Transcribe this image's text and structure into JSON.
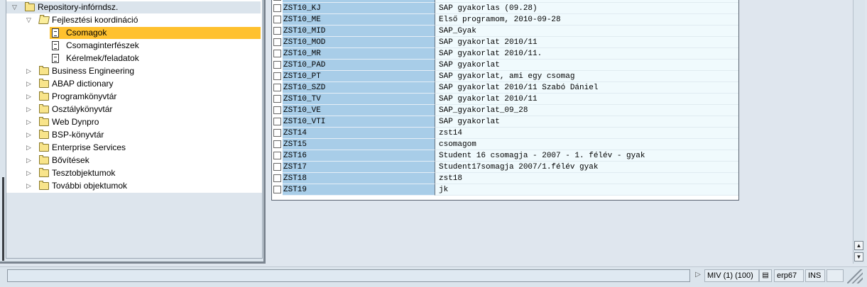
{
  "tree": {
    "nodes": [
      {
        "label": "Repository-infórndsz.",
        "toggle": "open"
      },
      {
        "label": "Fejlesztési koordináció",
        "toggle": "open"
      },
      {
        "label": "Csomagok",
        "selected": true
      },
      {
        "label": "Csomaginterfészek"
      },
      {
        "label": "Kérelmek/feladatok"
      },
      {
        "label": "Business Engineering",
        "toggle": "closed"
      },
      {
        "label": "ABAP dictionary",
        "toggle": "closed"
      },
      {
        "label": "Programkönyvtár",
        "toggle": "closed"
      },
      {
        "label": "Osztálykönyvtár",
        "toggle": "closed"
      },
      {
        "label": "Web Dynpro",
        "toggle": "closed"
      },
      {
        "label": "BSP-könyvtár",
        "toggle": "closed"
      },
      {
        "label": "Enterprise Services",
        "toggle": "closed"
      },
      {
        "label": "Bővítések",
        "toggle": "closed"
      },
      {
        "label": "Tesztobjektumok",
        "toggle": "closed"
      },
      {
        "label": "További objektumok",
        "toggle": "closed"
      }
    ]
  },
  "table": {
    "rows": [
      {
        "name": "ZST10_KJ",
        "desc": "SAP gyakorlas (09.28)"
      },
      {
        "name": "ZST10_ME",
        "desc": "Első programom, 2010-09-28"
      },
      {
        "name": "ZST10_MID",
        "desc": "SAP_Gyak"
      },
      {
        "name": "ZST10_MOD",
        "desc": "SAP gyakorlat 2010/11"
      },
      {
        "name": "ZST10_MR",
        "desc": "SAP gyakorlat 2010/11."
      },
      {
        "name": "ZST10_PAD",
        "desc": "SAP gyakorlat"
      },
      {
        "name": "ZST10_PT",
        "desc": "SAP gyakorlat, ami egy csomag"
      },
      {
        "name": "ZST10_SZD",
        "desc": "SAP gyakorlat 2010/11 Szabó Dániel"
      },
      {
        "name": "ZST10_TV",
        "desc": "SAP gyakorlat 2010/11"
      },
      {
        "name": "ZST10_VE",
        "desc": "SAP_gyakorlat_09_28"
      },
      {
        "name": "ZST10_VTI",
        "desc": "SAP gyakorlat"
      },
      {
        "name": "ZST14",
        "desc": "zst14"
      },
      {
        "name": "ZST15",
        "desc": "csomagom"
      },
      {
        "name": "ZST16",
        "desc": "Student 16 csomagja - 2007 - 1. félév - gyak"
      },
      {
        "name": "ZST17",
        "desc": "Student17somagja 2007/1.félév gyak"
      },
      {
        "name": "ZST18",
        "desc": "zst18"
      },
      {
        "name": "ZST19",
        "desc": "jk"
      }
    ]
  },
  "statusbar": {
    "system": "MIV (1) (100)",
    "server": "erp67",
    "mode": "INS"
  },
  "colors": {
    "selected": "#ffc12e",
    "key_column": "#a8cde8",
    "value_column": "#f0fafd"
  },
  "icons": {
    "folder": "folder-icon",
    "document": "document-icon",
    "expand": "triangle-right-icon",
    "collapse": "triangle-down-icon"
  }
}
